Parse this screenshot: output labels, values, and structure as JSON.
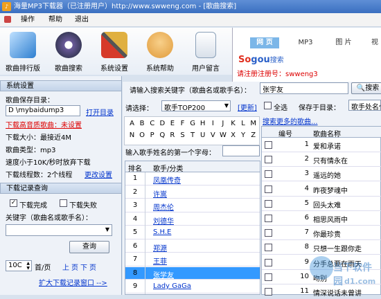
{
  "window": {
    "title": "海量MP3下载器（已注册用户）http://www.swweng.com - [歌曲搜索]",
    "icon": "app-icon"
  },
  "menu": [
    "操作",
    "帮助",
    "退出"
  ],
  "toolbar": [
    {
      "label": "歌曲排行版",
      "icon": "chart-icon",
      "color": "#2e7fd0"
    },
    {
      "label": "歌曲搜索",
      "icon": "vinyl-icon",
      "color": "#6a5a9a"
    },
    {
      "label": "系统设置",
      "icon": "tools-icon",
      "color": "#d63a2a"
    },
    {
      "label": "系统帮助",
      "icon": "read-me-icon",
      "color": "#e09a3a"
    },
    {
      "label": "用户留言",
      "icon": "document-icon",
      "color": "#8aa0b8"
    }
  ],
  "browser": {
    "tabs": [
      "网 页",
      "MP3",
      "图 片",
      "视"
    ],
    "logo": "Sogou搜索",
    "register_note": "请注册注册号：swweng3"
  },
  "settings": {
    "header": "系统设置",
    "save_dir_label": "歌曲保存目录：",
    "save_dir_value": "D \\mybaidump3",
    "open_dir_link": "打开目录",
    "hq_setting": "下载高音质歌曲：未设置",
    "size_label": "下载大小：最接近4M",
    "type_label": "歌曲类型：mp3",
    "speed_label": "速度小于10K/秒时放弃下载",
    "threads_label": "下载线程数：2个线程",
    "change_link": "更改设置"
  },
  "records": {
    "header": "下载记录查询",
    "done_label": "下载完成",
    "fail_label": "下载失败",
    "keyword_label": "关键字（歌曲名或歌手名）：",
    "query_button": "查询",
    "page_size": "10C",
    "page_unit": "首/页",
    "prev": "上",
    "next": "页",
    "next2": "下",
    "last": "页",
    "expand_link": "扩大下载记录窗口 -->"
  },
  "search": {
    "prompt": "请输入搜索关键字（歌曲名或歌手名）：",
    "keyword": "张宇友",
    "search_button": "搜索",
    "choose_label": "请选择：",
    "choose_value": "歌手TOP200",
    "refresh_link": "[更新]",
    "select_all": "全选",
    "save_to_label": "保存于目录：",
    "save_to_value": "歌手处名仁",
    "more_link": "搜索更多的歌曲...",
    "letters_row1": [
      "A",
      "B",
      "C",
      "D",
      "E",
      "F",
      "G",
      "H",
      "I",
      "J",
      "K",
      "L",
      "M"
    ],
    "letters_row2": [
      "N",
      "O",
      "P",
      "Q",
      "R",
      "S",
      "T",
      "U",
      "V",
      "W",
      "X",
      "Y",
      "Z"
    ],
    "first_letter_prompt": "输入歌手姓名的第一个字母：",
    "list_headers": [
      "排名",
      "歌手/分类"
    ],
    "singers": [
      {
        "rank": "1",
        "name": "凤凰传奇"
      },
      {
        "rank": "2",
        "name": "许嵩"
      },
      {
        "rank": "3",
        "name": "周杰伦"
      },
      {
        "rank": "4",
        "name": "刘德华"
      },
      {
        "rank": "5",
        "name": "S.H.E"
      },
      {
        "rank": "6",
        "name": "郑源"
      },
      {
        "rank": "7",
        "name": "王菲"
      },
      {
        "rank": "8",
        "name": "张学友"
      },
      {
        "rank": "9",
        "name": "Lady GaGa"
      }
    ],
    "selected_rank": "8"
  },
  "results": {
    "headers": [
      "编号",
      "歌曲名称"
    ],
    "rows": [
      {
        "no": "1",
        "title": "爱和承诺"
      },
      {
        "no": "2",
        "title": "只有情永在"
      },
      {
        "no": "3",
        "title": "遥远的她"
      },
      {
        "no": "4",
        "title": "昨夜梦魂中"
      },
      {
        "no": "5",
        "title": "回头太难"
      },
      {
        "no": "6",
        "title": "相思风雨中"
      },
      {
        "no": "7",
        "title": "你最珍贵"
      },
      {
        "no": "8",
        "title": "只想一生跟你走"
      },
      {
        "no": "9",
        "title": "分手总要在雨天"
      },
      {
        "no": "10",
        "title": "吻别"
      },
      {
        "no": "11",
        "title": "情深说话未曾讲"
      }
    ]
  },
  "watermark": {
    "brand": "当下软件园",
    "url": "d1.com"
  }
}
